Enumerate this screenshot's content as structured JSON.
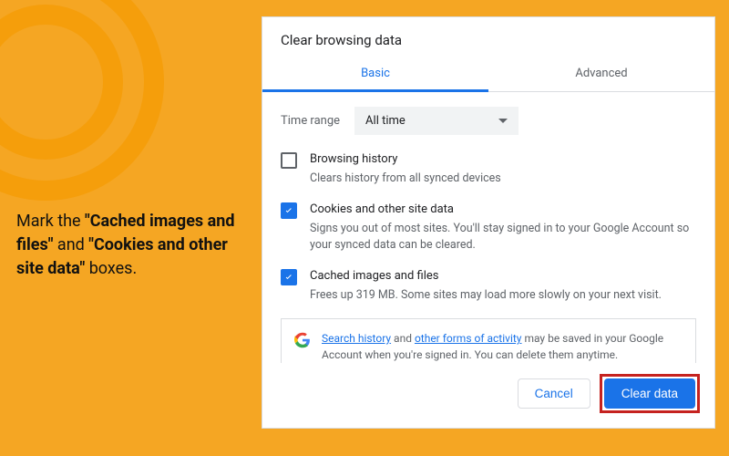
{
  "instruction": {
    "prefix": "Mark the ",
    "bold1": "\"Cached images and files\"",
    "mid": " and ",
    "bold2": "\"Cookies and other site data\"",
    "suffix": " boxes."
  },
  "dialog": {
    "title": "Clear browsing data",
    "tabs": {
      "basic": "Basic",
      "advanced": "Advanced"
    },
    "time_label": "Time range",
    "time_value": "All time",
    "options": [
      {
        "title": "Browsing history",
        "desc": "Clears history from all synced devices",
        "checked": false
      },
      {
        "title": "Cookies and other site data",
        "desc": "Signs you out of most sites. You'll stay signed in to your Google Account so your synced data can be cleared.",
        "checked": true
      },
      {
        "title": "Cached images and files",
        "desc": "Frees up 319 MB. Some sites may load more slowly on your next visit.",
        "checked": true
      }
    ],
    "info": {
      "link1": "Search history",
      "mid1": " and ",
      "link2": "other forms of activity",
      "rest": " may be saved in your Google Account when you're signed in. You can delete them anytime."
    },
    "buttons": {
      "cancel": "Cancel",
      "clear": "Clear data"
    }
  }
}
